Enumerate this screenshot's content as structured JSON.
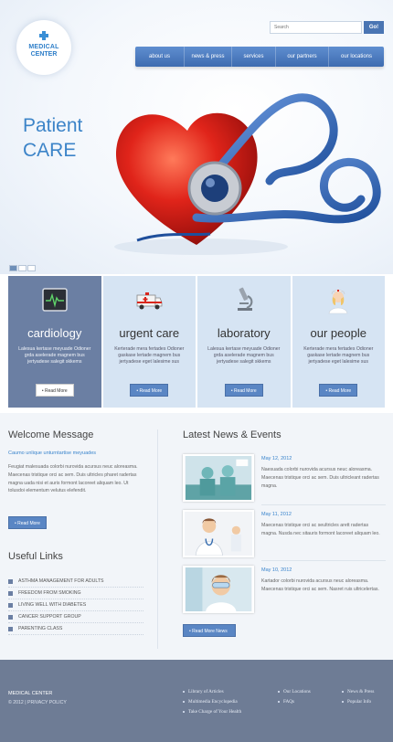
{
  "brand": {
    "line1": "MEDICAL",
    "line2": "CENTER"
  },
  "search": {
    "placeholder": "Search",
    "button": "Go!"
  },
  "nav": [
    "about us",
    "news & press",
    "services",
    "our partners",
    "our locations"
  ],
  "hero": {
    "line1": "Patient",
    "line2": "CARE"
  },
  "services": [
    {
      "title": "cardiology",
      "text": "Lalesua kertase meyuade Odioner grda aselerade magnem bus jertyadese salegit skkems",
      "button": "• Read More"
    },
    {
      "title": "urgent care",
      "text": "Kerterade mera fertades Odioner gaskase lertade magnem bus jertyadese eget lalesime sus",
      "button": "• Read More"
    },
    {
      "title": "laboratory",
      "text": "Lalesua kertase meyuade Odioner grda aselerade magnem bus jertyadese salegit skkems",
      "button": "• Read More"
    },
    {
      "title": "our people",
      "text": "Kerterade mera fertades Odioner gaskase lertade magnem bus jertyadese eget lalesime sus",
      "button": "• Read More"
    }
  ],
  "welcome": {
    "title": "Welcome Message",
    "subtitle": "Caumo unlique unturntartise meyuades",
    "text": "Feugiat malesuada colorbi nurovida acursus neuc aloreasma. Maecenas tristique orci ac sem. Duis ultricles pharet radertas magna uada nisi et auris formont lacoreet aliquam leo. Ut tolusdoi elementum velutus elefendit.",
    "button": "• Read More"
  },
  "useful_links": {
    "title": "Useful Links",
    "items": [
      "ASTHMA MANAGEMENT FOR ADULTS",
      "FREEDOM FROM SMOKING",
      "LIVING WELL WITH DIABETES",
      "CANCER SUPPORT GROUP",
      "PARENTING CLASS"
    ]
  },
  "news": {
    "title": "Latest News & Events",
    "items": [
      {
        "date": "May 12, 2012",
        "text": "Naesuada colorbi nurovida acursus neuc aloreasma. Maecenas tristique orci ac sem. Duis ultricleant radertas magna."
      },
      {
        "date": "May 11, 2012",
        "text": "Maecenas tristique orci ac seultricles arett radertas magna. Nusda nec sitauris formont lacoreet aliquam leo."
      },
      {
        "date": "May 10, 2012",
        "text": "Kartador colorbi nurovida acursus neuc aloreasma. Maecenas tristique orci ac sem. Nasret ruis ultricelertas."
      }
    ],
    "button": "• Read More News"
  },
  "footer": {
    "brand": "MEDICAL CENTER",
    "copyright": "© 2012  |  PRIVACY POLICY",
    "col1": [
      "Library of Articles",
      "Multimedia Encyclopedia",
      "Take Charge of Your Health"
    ],
    "col2": [
      "Our Locations",
      "FAQs"
    ],
    "col3": [
      "News & Press",
      "Popular Info"
    ]
  },
  "colors": {
    "accent": "#3a84cc",
    "nav": "#4a75b3",
    "active_tile": "#6b7fa3",
    "tile": "#d6e4f3",
    "footer": "#6e7c95"
  }
}
